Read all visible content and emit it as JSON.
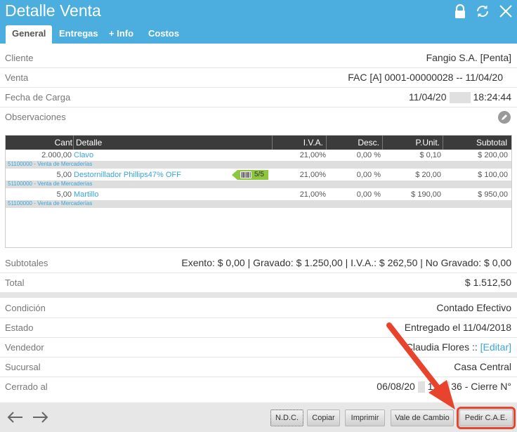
{
  "window": {
    "title": "Detalle Venta"
  },
  "tabs": [
    {
      "label": "General"
    },
    {
      "label": "Entregas"
    },
    {
      "label": "+ Info"
    },
    {
      "label": "Costos"
    }
  ],
  "fields": {
    "cliente": {
      "label": "Cliente",
      "value": "Fangio S.A. [Penta]"
    },
    "venta": {
      "label": "Venta",
      "value": "FAC [A] 0001-00000028 -- 11/04/20"
    },
    "fecha": {
      "label": "Fecha de Carga",
      "value_date": "11/04/20",
      "value_time": "18:24:44"
    },
    "observaciones": {
      "label": "Observaciones"
    }
  },
  "table": {
    "headers": {
      "cant": "Cant",
      "detalle": "Detalle",
      "iva": "I.V.A.",
      "desc": "Desc.",
      "punit": "P.Unit.",
      "subtotal": "Subtotal"
    },
    "rows": [
      {
        "cant": "2.000,00",
        "detalle": "Clavo",
        "iva": "21,00%",
        "desc": "0,00 %",
        "punit": "$ 0,10",
        "subtotal": "$ 200,00",
        "account": "51100000 - Venta de Mercaderías"
      },
      {
        "cant": "5,00",
        "detalle": "Destornillador Phillips47% OFF",
        "iva": "21,00%",
        "desc": "0,00 %",
        "punit": "$ 20,00",
        "subtotal": "$ 100,00",
        "account": "51100000 - Venta de Mercaderías",
        "badge": "5/5"
      },
      {
        "cant": "5,00",
        "detalle": "Martillo",
        "iva": "21,00%",
        "desc": "0,00 %",
        "punit": "$ 190,00",
        "subtotal": "$ 950,00",
        "account": "51100000 - Venta de Mercaderías"
      }
    ]
  },
  "totals": {
    "subtotales": {
      "label": "Subtotales",
      "value": "Exento: $ 0,00 | Gravado: $ 1.250,00 | I.V.A.: $ 262,50 | No Gravado: $ 0,00"
    },
    "total": {
      "label": "Total",
      "value": "$ 1.512,50"
    }
  },
  "info": {
    "condicion": {
      "label": "Condición",
      "value": "Contado Efectivo"
    },
    "estado": {
      "label": "Estado",
      "value": "Entregado el 11/04/2018"
    },
    "vendedor": {
      "label": "Vendedor",
      "value": "Claudia Flores ::",
      "link": "[Editar]"
    },
    "sucursal": {
      "label": "Sucursal",
      "value": "Casa Central"
    },
    "cerrado": {
      "label": "Cerrado al",
      "value_a": "06/08/20",
      "value_b": "19.",
      "value_c": "36 - Cierre N°"
    }
  },
  "footer": {
    "buttons": [
      {
        "label": "N.D.C."
      },
      {
        "label": "Copiar"
      },
      {
        "label": "Imprimir"
      },
      {
        "label": "Vale de Cambio"
      },
      {
        "label": "Pedir C.A.E."
      }
    ]
  },
  "colors": {
    "accent": "#4baede",
    "highlight": "#e8432d",
    "promo": "#8dc63f"
  },
  "icons": [
    "lock-icon",
    "refresh-icon",
    "close-icon",
    "edit-icon",
    "barcode-icon",
    "back-arrow-icon",
    "forward-arrow-icon"
  ]
}
